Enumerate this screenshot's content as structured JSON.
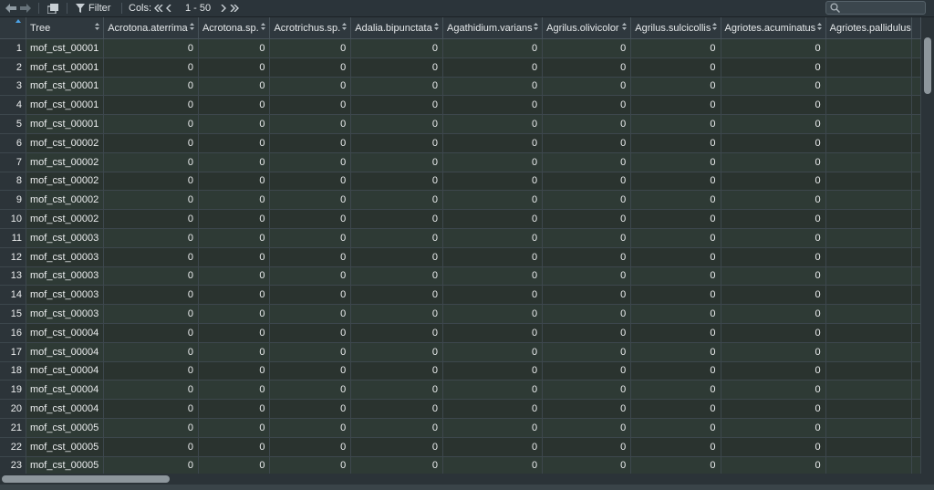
{
  "toolbar": {
    "filter_label": "Filter",
    "cols_label": "Cols:",
    "cols_range": "1 - 50",
    "search_value": ""
  },
  "table": {
    "columns": [
      {
        "label": "Tree",
        "align": "left"
      },
      {
        "label": "Acrotona.aterrima",
        "align": "right"
      },
      {
        "label": "Acrotona.sp.",
        "align": "right"
      },
      {
        "label": "Acrotrichus.sp.",
        "align": "right"
      },
      {
        "label": "Adalia.bipunctata",
        "align": "right"
      },
      {
        "label": "Agathidium.varians",
        "align": "right"
      },
      {
        "label": "Agrilus.olivicolor",
        "align": "right"
      },
      {
        "label": "Agrilus.sulcicollis",
        "align": "right"
      },
      {
        "label": "Agriotes.acuminatus",
        "align": "right"
      },
      {
        "label": "Agriotes.pallidulus",
        "align": "right"
      }
    ],
    "rows": [
      {
        "n": "1",
        "cells": [
          "mof_cst_00001",
          "0",
          "0",
          "0",
          "0",
          "0",
          "0",
          "0",
          "0",
          ""
        ]
      },
      {
        "n": "2",
        "cells": [
          "mof_cst_00001",
          "0",
          "0",
          "0",
          "0",
          "0",
          "0",
          "0",
          "0",
          ""
        ]
      },
      {
        "n": "3",
        "cells": [
          "mof_cst_00001",
          "0",
          "0",
          "0",
          "0",
          "0",
          "0",
          "0",
          "0",
          ""
        ]
      },
      {
        "n": "4",
        "cells": [
          "mof_cst_00001",
          "0",
          "0",
          "0",
          "0",
          "0",
          "0",
          "0",
          "0",
          ""
        ]
      },
      {
        "n": "5",
        "cells": [
          "mof_cst_00001",
          "0",
          "0",
          "0",
          "0",
          "0",
          "0",
          "0",
          "0",
          ""
        ]
      },
      {
        "n": "6",
        "cells": [
          "mof_cst_00002",
          "0",
          "0",
          "0",
          "0",
          "0",
          "0",
          "0",
          "0",
          ""
        ]
      },
      {
        "n": "7",
        "cells": [
          "mof_cst_00002",
          "0",
          "0",
          "0",
          "0",
          "0",
          "0",
          "0",
          "0",
          ""
        ]
      },
      {
        "n": "8",
        "cells": [
          "mof_cst_00002",
          "0",
          "0",
          "0",
          "0",
          "0",
          "0",
          "0",
          "0",
          ""
        ]
      },
      {
        "n": "9",
        "cells": [
          "mof_cst_00002",
          "0",
          "0",
          "0",
          "0",
          "0",
          "0",
          "0",
          "0",
          ""
        ]
      },
      {
        "n": "10",
        "cells": [
          "mof_cst_00002",
          "0",
          "0",
          "0",
          "0",
          "0",
          "0",
          "0",
          "0",
          ""
        ]
      },
      {
        "n": "11",
        "cells": [
          "mof_cst_00003",
          "0",
          "0",
          "0",
          "0",
          "0",
          "0",
          "0",
          "0",
          ""
        ]
      },
      {
        "n": "12",
        "cells": [
          "mof_cst_00003",
          "0",
          "0",
          "0",
          "0",
          "0",
          "0",
          "0",
          "0",
          ""
        ]
      },
      {
        "n": "13",
        "cells": [
          "mof_cst_00003",
          "0",
          "0",
          "0",
          "0",
          "0",
          "0",
          "0",
          "0",
          ""
        ]
      },
      {
        "n": "14",
        "cells": [
          "mof_cst_00003",
          "0",
          "0",
          "0",
          "0",
          "0",
          "0",
          "0",
          "0",
          ""
        ]
      },
      {
        "n": "15",
        "cells": [
          "mof_cst_00003",
          "0",
          "0",
          "0",
          "0",
          "0",
          "0",
          "0",
          "0",
          ""
        ]
      },
      {
        "n": "16",
        "cells": [
          "mof_cst_00004",
          "0",
          "0",
          "0",
          "0",
          "0",
          "0",
          "0",
          "0",
          ""
        ]
      },
      {
        "n": "17",
        "cells": [
          "mof_cst_00004",
          "0",
          "0",
          "0",
          "0",
          "0",
          "0",
          "0",
          "0",
          ""
        ]
      },
      {
        "n": "18",
        "cells": [
          "mof_cst_00004",
          "0",
          "0",
          "0",
          "0",
          "0",
          "0",
          "0",
          "0",
          ""
        ]
      },
      {
        "n": "19",
        "cells": [
          "mof_cst_00004",
          "0",
          "0",
          "0",
          "0",
          "0",
          "0",
          "0",
          "0",
          ""
        ]
      },
      {
        "n": "20",
        "cells": [
          "mof_cst_00004",
          "0",
          "0",
          "0",
          "0",
          "0",
          "0",
          "0",
          "0",
          ""
        ]
      },
      {
        "n": "21",
        "cells": [
          "mof_cst_00005",
          "0",
          "0",
          "0",
          "0",
          "0",
          "0",
          "0",
          "0",
          ""
        ]
      },
      {
        "n": "22",
        "cells": [
          "mof_cst_00005",
          "0",
          "0",
          "0",
          "0",
          "0",
          "0",
          "0",
          "0",
          ""
        ]
      },
      {
        "n": "23",
        "cells": [
          "mof_cst_00005",
          "0",
          "0",
          "0",
          "0",
          "0",
          "0",
          "0",
          "0",
          ""
        ]
      }
    ]
  },
  "colors": {
    "background": "#232b30",
    "header_bg": "#2f383e",
    "row_odd": "#2e3a35",
    "row_even": "#2a332f",
    "sort_accent": "#4da3e6",
    "scroll_thumb": "#8d969c"
  },
  "icons": {
    "back": "arrow-left-icon",
    "forward": "arrow-right-icon",
    "popout": "popout-icon",
    "filter": "filter-icon",
    "cols_first": "double-chevron-left-icon",
    "cols_prev": "chevron-left-icon",
    "cols_next": "chevron-right-icon",
    "cols_last": "double-chevron-right-icon",
    "search": "search-icon"
  }
}
